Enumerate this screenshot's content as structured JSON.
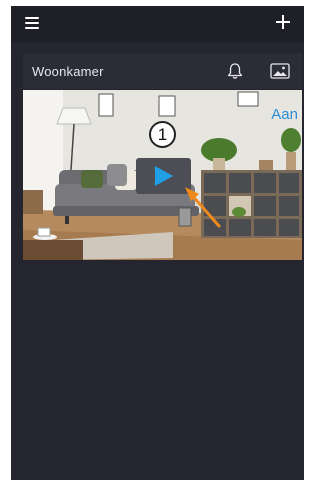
{
  "header": {
    "menu_icon": "hamburger-menu-icon",
    "add_icon": "plus-icon"
  },
  "device_card": {
    "name": "Woonkamer",
    "bell_icon": "bell-icon",
    "gallery_icon": "image-gallery-icon",
    "status": "Aan",
    "callout_number": "1",
    "play_icon": "play-icon"
  },
  "colors": {
    "background": "#25252f",
    "topbar": "#1f1f28",
    "card_header": "#2c2c37",
    "status_blue": "#2a8fd8",
    "play_blue": "#1fa0e6",
    "arrow_orange": "#f08a1c"
  }
}
